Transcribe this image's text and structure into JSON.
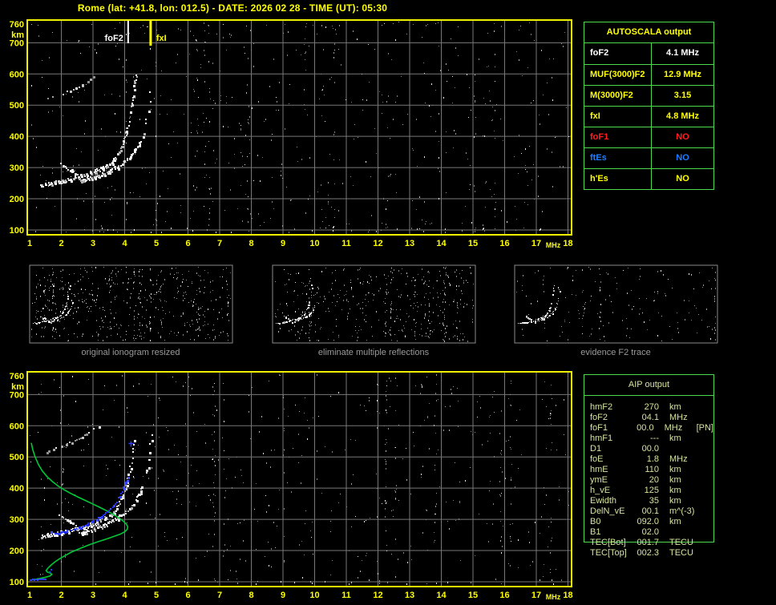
{
  "title": "Rome (lat: +41.8, lon: 012.5) - DATE: 2026 02 28 - TIME (UT): 05:30",
  "colors": {
    "accent_yellow": "#ffff00",
    "frame_yellow": "#efef00",
    "grid_gray": "#787878",
    "table_border_green": "#4ed84e",
    "aip_text": "#d6e49e",
    "caption_gray": "#9a9a9a",
    "thumb_border_gray": "#8a8a8a",
    "profile_green": "#00c838",
    "restored_blue": "#2e3cff",
    "marker_white": "#ffffff",
    "status_red": "#ff2020",
    "status_blue": "#1f7bff"
  },
  "autoscala_table": {
    "title": "AUTOSCALA output",
    "rows": [
      {
        "label": "foF2",
        "value": "4.1 MHz",
        "color": "#ffffff"
      },
      {
        "label": "MUF(3000)F2",
        "value": "12.9 MHz",
        "color": "#ffff00"
      },
      {
        "label": "M(3000)F2",
        "value": "3.15",
        "color": "#ffff00"
      },
      {
        "label": "fxI",
        "value": "4.8 MHz",
        "color": "#ffff00"
      },
      {
        "label": "foF1",
        "value": "NO",
        "color": "#ff2020"
      },
      {
        "label": "ftEs",
        "value": "NO",
        "color": "#1f7bff"
      },
      {
        "label": "h'Es",
        "value": "NO",
        "color": "#ffff00"
      }
    ]
  },
  "aip_table": {
    "title": "AIP output",
    "rows": [
      {
        "label": "hmF2",
        "value": "270",
        "unit": "km",
        "note": ""
      },
      {
        "label": "foF2",
        "value": "04.1",
        "unit": "MHz",
        "note": ""
      },
      {
        "label": "foF1",
        "value": "00.0",
        "unit": "MHz",
        "note": "[PN]"
      },
      {
        "label": "hmF1",
        "value": "---",
        "unit": "km",
        "note": ""
      },
      {
        "label": "D1",
        "value": "00.0",
        "unit": "",
        "note": ""
      },
      {
        "label": "foE",
        "value": "1.8",
        "unit": "MHz",
        "note": ""
      },
      {
        "label": "hmE",
        "value": "110",
        "unit": "km",
        "note": ""
      },
      {
        "label": "ymE",
        "value": "20",
        "unit": "km",
        "note": ""
      },
      {
        "label": "h_vE",
        "value": "125",
        "unit": "km",
        "note": ""
      },
      {
        "label": "Ewidth",
        "value": "35",
        "unit": "km",
        "note": ""
      },
      {
        "label": "DelN_vE",
        "value": "00.1",
        "unit": "m^(-3)",
        "note": ""
      },
      {
        "label": "B0",
        "value": "092.0",
        "unit": "km",
        "note": ""
      },
      {
        "label": "B1",
        "value": "02.0",
        "unit": "",
        "note": ""
      },
      {
        "label": "TEC[Bot]",
        "value": "001.7",
        "unit": "TECU",
        "note": ""
      },
      {
        "label": "TEC[Top]",
        "value": "002.3",
        "unit": "TECU",
        "note": ""
      }
    ]
  },
  "thumbnails": [
    {
      "caption": "original ionogram resized"
    },
    {
      "caption": "eliminate multiple reflections"
    },
    {
      "caption": "evidence F2 trace"
    }
  ],
  "chart_data": {
    "type": "scatter",
    "title": "vertical-incidence ionogram, Rome, 2026-02-28 05:30 UT",
    "xlabel": "MHz",
    "ylabel": "km",
    "xlim": [
      1,
      18.1
    ],
    "ylim": [
      85,
      765
    ],
    "x_ticks": [
      1,
      2,
      3,
      4,
      5,
      6,
      7,
      8,
      9,
      10,
      11,
      12,
      13,
      14,
      15,
      16,
      17,
      18
    ],
    "y_ticks": [
      760,
      700,
      600,
      500,
      400,
      300,
      200,
      100
    ],
    "grid": true,
    "markers": {
      "foF2_label": "foF2",
      "foF2_mhz": 4.11,
      "fxI_label": "fxI",
      "fxI_mhz": 4.82
    },
    "traces": {
      "f2_ordinary": [
        [
          1.35,
          247
        ],
        [
          1.5,
          250
        ],
        [
          1.65,
          253
        ],
        [
          1.8,
          256
        ],
        [
          1.95,
          259
        ],
        [
          2.1,
          262
        ],
        [
          2.25,
          265
        ],
        [
          2.4,
          269
        ],
        [
          2.55,
          273
        ],
        [
          2.7,
          277
        ],
        [
          2.85,
          282
        ],
        [
          3.0,
          288
        ],
        [
          3.15,
          294
        ],
        [
          3.3,
          301
        ],
        [
          3.45,
          310
        ],
        [
          3.6,
          321
        ],
        [
          3.72,
          334
        ],
        [
          3.82,
          349
        ],
        [
          3.9,
          366
        ],
        [
          3.98,
          386
        ],
        [
          4.05,
          408
        ],
        [
          4.1,
          430
        ],
        [
          4.15,
          452
        ],
        [
          4.19,
          475
        ],
        [
          4.23,
          500
        ],
        [
          4.27,
          527
        ],
        [
          4.3,
          553
        ],
        [
          4.33,
          578
        ],
        [
          4.35,
          600
        ]
      ],
      "f2_extraordinary": [
        [
          2.6,
          259
        ],
        [
          2.75,
          263
        ],
        [
          2.9,
          267
        ],
        [
          3.05,
          272
        ],
        [
          3.2,
          277
        ],
        [
          3.35,
          283
        ],
        [
          3.5,
          290
        ],
        [
          3.65,
          298
        ],
        [
          3.8,
          307
        ],
        [
          3.95,
          317
        ],
        [
          4.1,
          328
        ],
        [
          4.22,
          341
        ],
        [
          4.33,
          356
        ],
        [
          4.43,
          373
        ],
        [
          4.52,
          392
        ],
        [
          4.6,
          413
        ],
        [
          4.66,
          435
        ],
        [
          4.71,
          458
        ],
        [
          4.75,
          482
        ],
        [
          4.78,
          507
        ],
        [
          4.81,
          532
        ],
        [
          4.83,
          556
        ],
        [
          4.85,
          580
        ]
      ],
      "fork_branch": [
        [
          1.95,
          312
        ],
        [
          2.1,
          302
        ],
        [
          2.25,
          293
        ],
        [
          2.4,
          285
        ],
        [
          2.55,
          279
        ]
      ],
      "second_hop": [
        [
          1.45,
          517
        ],
        [
          1.6,
          521
        ],
        [
          1.75,
          526
        ],
        [
          1.9,
          531
        ],
        [
          2.05,
          536
        ],
        [
          2.2,
          542
        ],
        [
          2.35,
          549
        ],
        [
          2.5,
          557
        ],
        [
          2.65,
          566
        ],
        [
          2.8,
          576
        ],
        [
          2.95,
          586
        ],
        [
          3.1,
          594
        ],
        [
          3.2,
          600
        ]
      ]
    },
    "profile_green": [
      [
        1.05,
        545
      ],
      [
        1.1,
        522
      ],
      [
        1.18,
        498
      ],
      [
        1.28,
        475
      ],
      [
        1.4,
        455
      ],
      [
        1.55,
        437
      ],
      [
        1.72,
        421
      ],
      [
        1.9,
        407
      ],
      [
        2.1,
        394
      ],
      [
        2.3,
        383
      ],
      [
        2.52,
        372
      ],
      [
        2.75,
        361
      ],
      [
        2.98,
        350
      ],
      [
        3.2,
        339
      ],
      [
        3.42,
        328
      ],
      [
        3.62,
        317
      ],
      [
        3.8,
        306
      ],
      [
        3.95,
        295
      ],
      [
        4.05,
        285
      ],
      [
        4.1,
        276
      ],
      [
        4.08,
        268
      ],
      [
        4.0,
        260
      ],
      [
        3.85,
        252
      ],
      [
        3.65,
        245
      ],
      [
        3.42,
        237
      ],
      [
        3.18,
        229
      ],
      [
        2.95,
        221
      ],
      [
        2.72,
        212
      ],
      [
        2.5,
        203
      ],
      [
        2.3,
        194
      ],
      [
        2.12,
        184
      ],
      [
        1.95,
        174
      ],
      [
        1.8,
        164
      ],
      [
        1.68,
        154
      ],
      [
        1.58,
        144
      ],
      [
        1.52,
        136
      ],
      [
        1.56,
        131
      ],
      [
        1.65,
        128
      ],
      [
        1.7,
        124
      ],
      [
        1.65,
        119
      ],
      [
        1.52,
        115
      ],
      [
        1.35,
        111
      ],
      [
        1.18,
        108
      ],
      [
        1.05,
        106
      ]
    ],
    "restored_trace_blue": [
      [
        1.7,
        259
      ],
      [
        1.8,
        257
      ],
      [
        1.9,
        256
      ],
      [
        2.0,
        258
      ],
      [
        2.1,
        261
      ],
      [
        2.2,
        263
      ],
      [
        2.3,
        266
      ],
      [
        2.4,
        269
      ],
      [
        2.5,
        272
      ],
      [
        2.6,
        276
      ],
      [
        2.7,
        280
      ],
      [
        2.8,
        284
      ],
      [
        2.9,
        289
      ],
      [
        3.0,
        294
      ],
      [
        3.1,
        300
      ],
      [
        3.2,
        306
      ],
      [
        3.3,
        313
      ],
      [
        3.4,
        321
      ],
      [
        3.5,
        330
      ],
      [
        3.6,
        340
      ],
      [
        3.7,
        351
      ],
      [
        3.78,
        363
      ],
      [
        3.85,
        376
      ],
      [
        3.92,
        390
      ],
      [
        3.98,
        404
      ],
      [
        4.03,
        418
      ],
      [
        4.08,
        432
      ],
      [
        4.12,
        444
      ]
    ],
    "restored_e_blue": [
      [
        1.0,
        107
      ],
      [
        1.05,
        107
      ],
      [
        1.1,
        108
      ],
      [
        1.15,
        107
      ],
      [
        1.2,
        108
      ],
      [
        1.25,
        107
      ],
      [
        1.3,
        108
      ],
      [
        1.35,
        108
      ],
      [
        1.4,
        109
      ],
      [
        1.45,
        109
      ],
      [
        1.5,
        110
      ],
      [
        1.62,
        133
      ],
      [
        1.68,
        139
      ]
    ],
    "isolated_blue_cross": [
      4.2,
      543
    ]
  }
}
